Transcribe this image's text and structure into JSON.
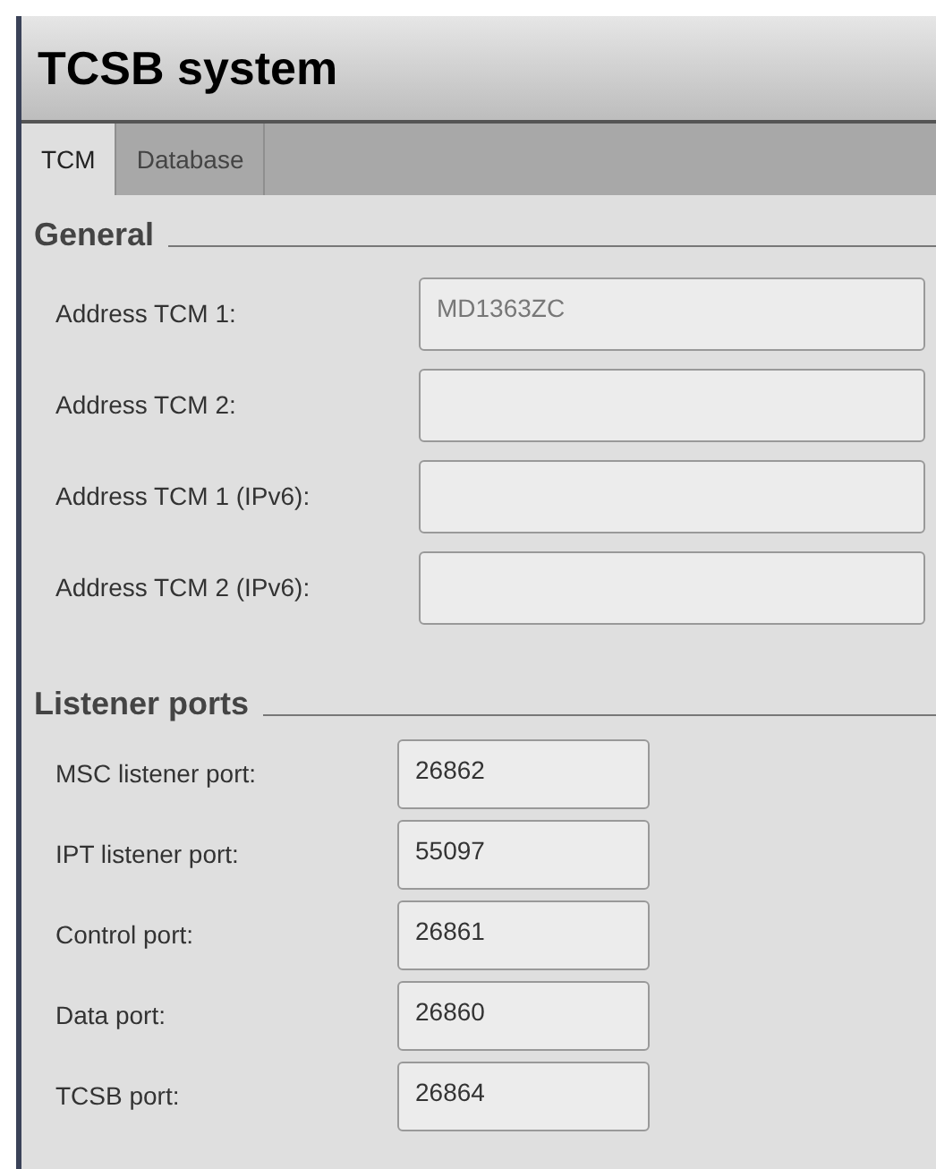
{
  "window": {
    "title": "TCSB system"
  },
  "tabs": [
    {
      "label": "TCM",
      "selected": true
    },
    {
      "label": "Database",
      "selected": false
    }
  ],
  "sections": [
    {
      "title": "General",
      "kind": "wide",
      "fields": [
        {
          "label": "Address TCM 1:",
          "placeholder": "MD1363ZC"
        },
        {
          "label": "Address TCM 2:"
        },
        {
          "label": "Address TCM 1 (IPv6):"
        },
        {
          "label": "Address TCM 2 (IPv6):"
        }
      ]
    },
    {
      "title": "Listener ports",
      "kind": "narrow",
      "fields": [
        {
          "label": "MSC listener port:",
          "value": "26862"
        },
        {
          "label": "IPT listener port:",
          "value": "55097"
        },
        {
          "label": "Control port:",
          "value": "26861"
        },
        {
          "label": "Data port:",
          "value": "26860"
        },
        {
          "label": "TCSB port:",
          "value": "26864"
        }
      ]
    }
  ]
}
